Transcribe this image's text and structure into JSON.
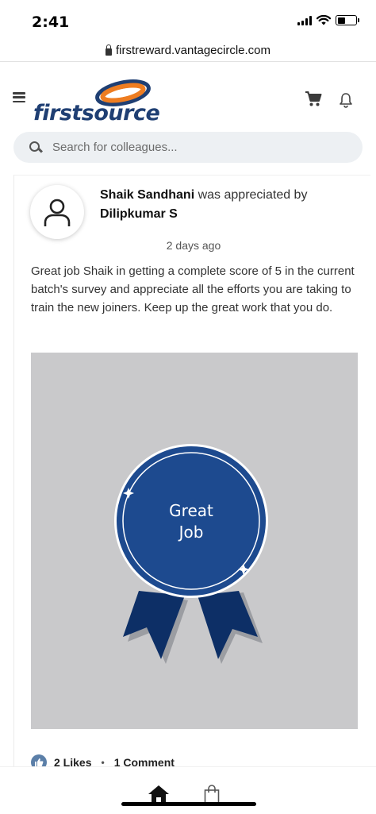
{
  "status_bar": {
    "time": "2:41"
  },
  "browser": {
    "url": "firstreward.vantagecircle.com"
  },
  "header": {
    "logo_text": "firstsource"
  },
  "search": {
    "placeholder": "Search for colleagues..."
  },
  "post": {
    "recipient": "Shaik Sandhani",
    "action_text": "was appreciated by",
    "sender": "Dilipkumar S",
    "timestamp": "2 days ago",
    "message": "Great job Shaik in getting a complete score of 5 in the current batch's survey and appreciate all the efforts you are taking to train the new joiners. Keep up the great work that you do.",
    "badge": {
      "line1": "Great",
      "line2": "Job"
    },
    "likes": "2 Likes",
    "separator": "•",
    "comments": "1 Comment"
  },
  "colors": {
    "brand_blue": "#1f3f73",
    "brand_orange": "#ee7d21",
    "badge_blue": "#1d4a8f",
    "ribbon_blue": "#0d2f66",
    "badge_background": "#c9c9cb"
  },
  "icons": [
    "lock-icon",
    "menu-icon",
    "cart-icon",
    "bell-icon",
    "search-icon",
    "user-icon",
    "like-icon",
    "home-icon",
    "bag-icon"
  ]
}
